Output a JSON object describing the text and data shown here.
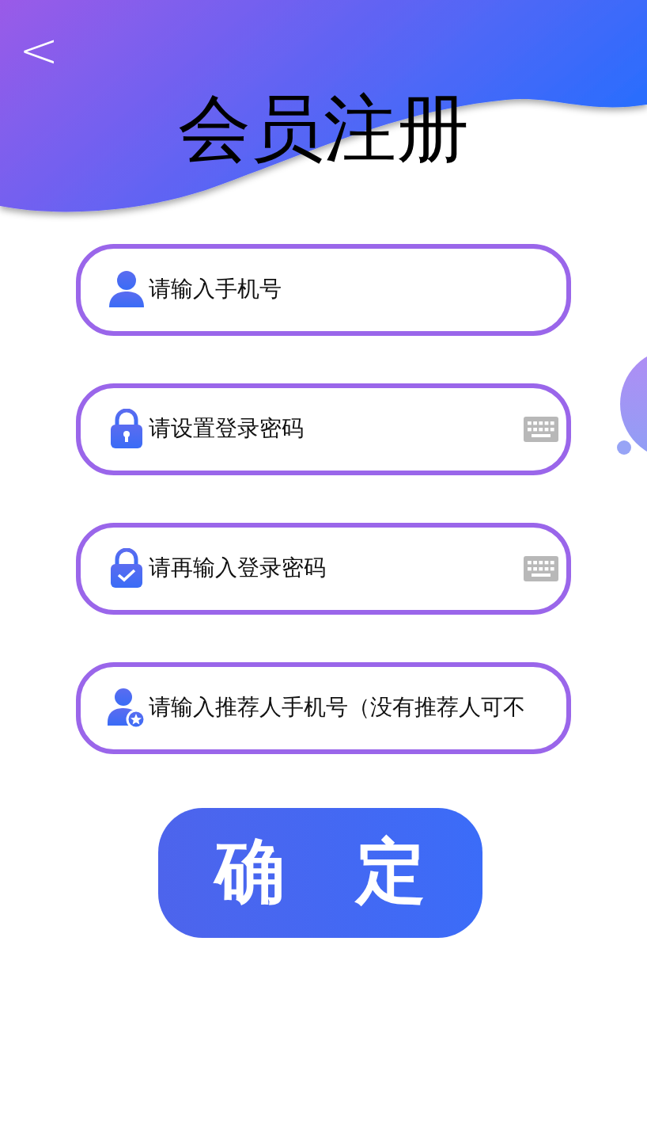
{
  "header": {
    "back": "<",
    "title": "会员注册"
  },
  "fields": [
    {
      "kind": "phone",
      "placeholder": "请输入手机号",
      "keyboard": false
    },
    {
      "kind": "password",
      "placeholder": "请设置登录密码",
      "keyboard": true
    },
    {
      "kind": "confirm",
      "placeholder": "请再输入登录密码",
      "keyboard": true
    },
    {
      "kind": "referrer",
      "placeholder": "请输入推荐人手机号（没有推荐人可不",
      "keyboard": false
    }
  ],
  "submit": {
    "label": "确 定"
  }
}
